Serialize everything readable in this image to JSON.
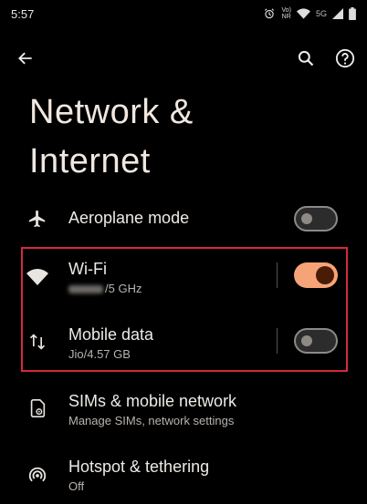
{
  "status_bar": {
    "time": "5:57",
    "volte_top": "Vo)",
    "volte_bottom": "NR",
    "network_label": "5G"
  },
  "page": {
    "title_line1": "Network &",
    "title_line2": "Internet"
  },
  "rows": {
    "aeroplane": {
      "title": "Aeroplane mode",
      "toggle": "off"
    },
    "wifi": {
      "title": "Wi-Fi",
      "subtitle_suffix": "/5 GHz",
      "toggle": "on"
    },
    "mobile_data": {
      "title": "Mobile data",
      "subtitle": "Jio/4.57 GB",
      "toggle": "off"
    },
    "sims": {
      "title": "SIMs & mobile network",
      "subtitle": "Manage SIMs, network settings"
    },
    "hotspot": {
      "title": "Hotspot & tethering",
      "subtitle": "Off"
    }
  },
  "icons": [
    "arrow-back-icon",
    "search-icon",
    "help-icon",
    "airplane-icon",
    "wifi-icon",
    "swap-vertical-icon",
    "sim-settings-icon",
    "hotspot-icon"
  ],
  "colors": {
    "toggle_on": "#f6a477",
    "highlight": "#d6293d",
    "background": "#000000"
  }
}
